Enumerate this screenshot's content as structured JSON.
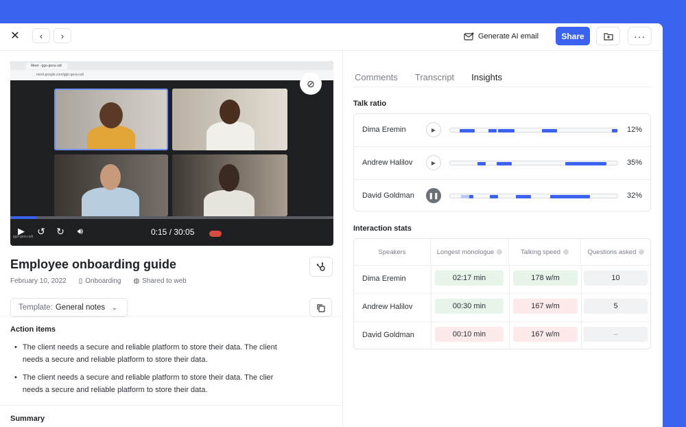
{
  "toolbar": {
    "close_icon": "close-icon",
    "back_icon": "chevron-left-icon",
    "forward_icon": "chevron-right-icon",
    "generate_ai_email_label": "Generate AI email",
    "share_label": "Share",
    "folder_icon": "folder-add-icon",
    "more_icon": "more-icon"
  },
  "video": {
    "time_text": "0:15 / 30:05",
    "progress": 0.08,
    "browser_tab": "Meet - ggo-gexu-udi",
    "browser_url": "meet.google.com/ggo-gexu-udi",
    "footer_left": "ggo-gexu-udi"
  },
  "document": {
    "title": "Employee onboarding guide",
    "date": "February 10, 2022",
    "folder": "Onboarding",
    "shared": "Shared to web",
    "template_prefix": "Template:",
    "template_value": "General notes"
  },
  "action_items": {
    "heading": "Action items",
    "items": [
      "The client needs a secure and reliable platform to store their data. The client needs a secure and reliable platform to store their data.",
      "The client needs a secure and reliable platform to store their data. The clier needs a secure and reliable platform to store their data."
    ]
  },
  "summary": {
    "heading": "Summary"
  },
  "tabs": [
    "Comments",
    "Transcript",
    "Insights"
  ],
  "active_tab": "Insights",
  "talk_ratio": {
    "heading": "Talk ratio",
    "rows": [
      {
        "name": "Dima Eremin",
        "pct": "12%",
        "state": "play"
      },
      {
        "name": "Andrew Halilov",
        "pct": "35%",
        "state": "play"
      },
      {
        "name": "David Goldman",
        "pct": "32%",
        "state": "pause"
      }
    ]
  },
  "interaction_stats": {
    "heading": "Interaction stats",
    "columns": [
      "Speakers",
      "Longest monologue",
      "Talking speed",
      "Questions asked"
    ],
    "rows": [
      {
        "name": "Dima Eremin",
        "monologue": "02:17 min",
        "speed": "178 w/m",
        "questions": "10"
      },
      {
        "name": "Andrew Halilov",
        "monologue": "00:30 min",
        "speed": "167 w/m",
        "questions": "5"
      },
      {
        "name": "David Goldman",
        "monologue": "00:10 min",
        "speed": "167 w/m",
        "questions": "–"
      }
    ]
  },
  "colors": {
    "accent": "#3B63F0",
    "good": "#e6f4ea",
    "bad": "#fcebea"
  }
}
